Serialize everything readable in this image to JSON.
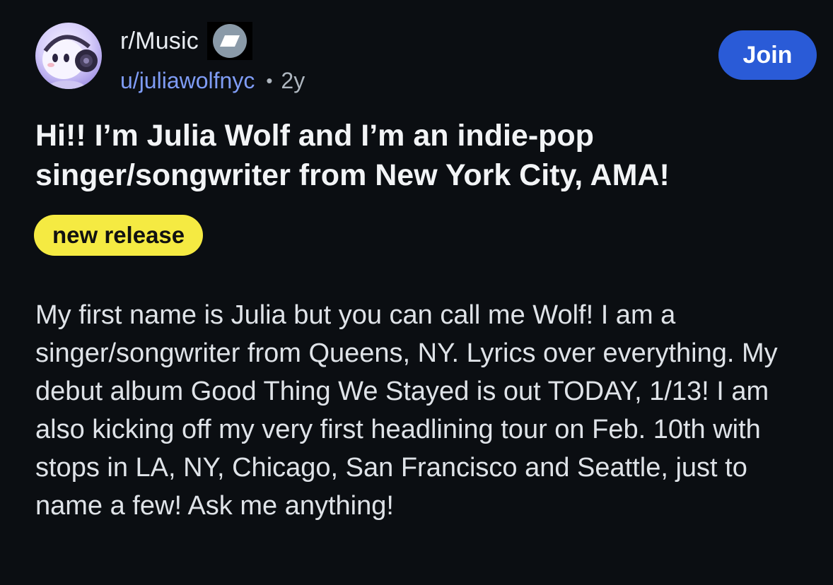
{
  "post": {
    "subreddit": "r/Music",
    "subreddit_flair_icon": "tag-icon",
    "author": "u/juliawolfnyc",
    "separator": "•",
    "age": "2y",
    "join_label": "Join",
    "title": "Hi!! I’m Julia Wolf and I’m an indie-pop singer/songwriter from New York City, AMA!",
    "flair": "new release",
    "body": "My first name is Julia but you can call me Wolf! I am a singer/songwriter from Queens, NY. Lyrics over everything. My debut album Good Thing We Stayed is out TODAY, 1/13! I am also kicking off my very first headlining tour on Feb. 10th with stops in LA, NY, Chicago, San Francisco and Seattle, just to name a few! Ask me anything!"
  },
  "colors": {
    "background": "#0b0e12",
    "username": "#7f9cf5",
    "join_button": "#2a5bd7",
    "flair_background": "#f5ea42",
    "flair_text": "#111111"
  }
}
